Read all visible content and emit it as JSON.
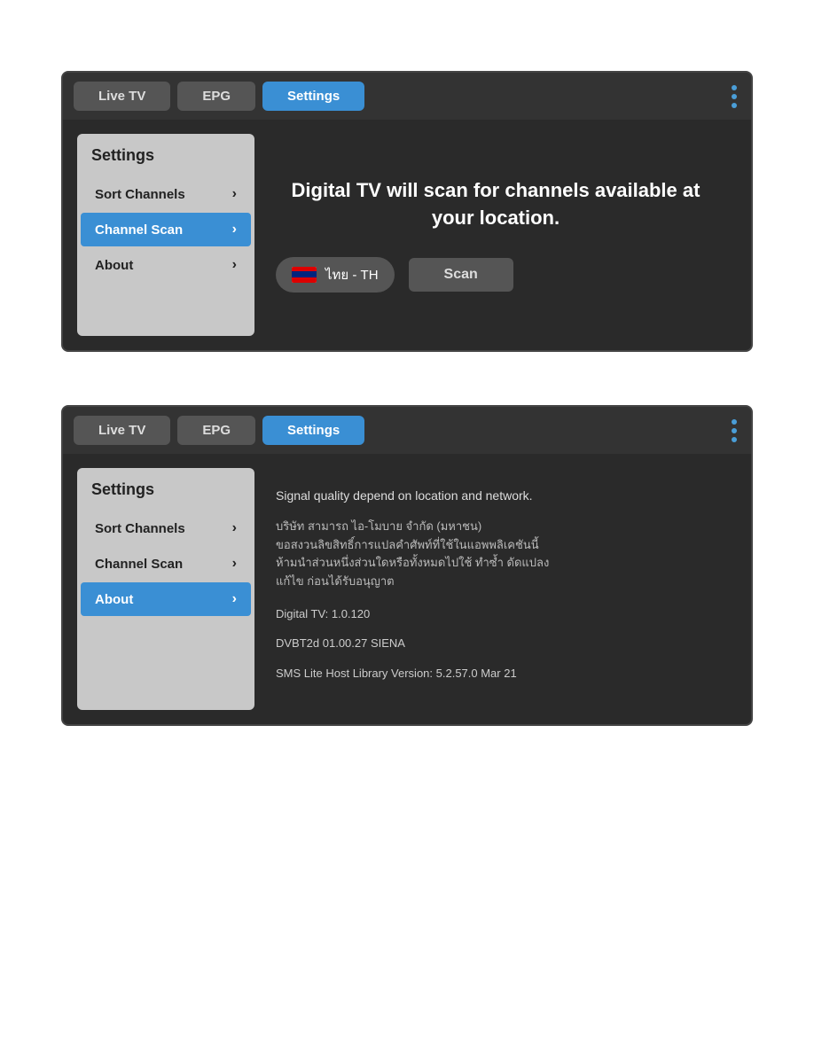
{
  "screen1": {
    "tabs": [
      {
        "id": "live-tv",
        "label": "Live TV",
        "active": false
      },
      {
        "id": "epg",
        "label": "EPG",
        "active": false
      },
      {
        "id": "settings",
        "label": "Settings",
        "active": true
      }
    ],
    "sidebar": {
      "title": "Settings",
      "items": [
        {
          "id": "sort-channels",
          "label": "Sort Channels",
          "active": false
        },
        {
          "id": "channel-scan",
          "label": "Channel Scan",
          "active": true
        },
        {
          "id": "about",
          "label": "About",
          "active": false
        }
      ]
    },
    "main": {
      "title": "Digital TV will scan for channels available at your location.",
      "language_label": "ไทย - TH",
      "scan_button": "Scan"
    }
  },
  "screen2": {
    "tabs": [
      {
        "id": "live-tv",
        "label": "Live TV",
        "active": false
      },
      {
        "id": "epg",
        "label": "EPG",
        "active": false
      },
      {
        "id": "settings",
        "label": "Settings",
        "active": true
      }
    ],
    "sidebar": {
      "title": "Settings",
      "items": [
        {
          "id": "sort-channels",
          "label": "Sort Channels",
          "active": false
        },
        {
          "id": "channel-scan",
          "label": "Channel Scan",
          "active": false
        },
        {
          "id": "about",
          "label": "About",
          "active": true
        }
      ]
    },
    "main": {
      "signal_quality": "Signal quality depend on location and network.",
      "thai_text": "บริษัท สามารถ ไอ-โมบาย จำกัด (มหาชน)\nขอสงวนลิขสิทธิ์การแปลคำศัพท์ที่ใช้ในแอพพลิเคชันนี้\nห้ามนำส่วนหนึ่งส่วนใดหรือทั้งหมดไปใช้ ทำซ้ำ ดัดแปลง\nแก้ไข ก่อนได้รับอนุญาต",
      "version": "Digital TV: 1.0.120",
      "dvbt": "DVBT2d 01.00.27 SIENA",
      "sms": "SMS Lite Host Library Version: 5.2.57.0 Mar 21"
    }
  }
}
